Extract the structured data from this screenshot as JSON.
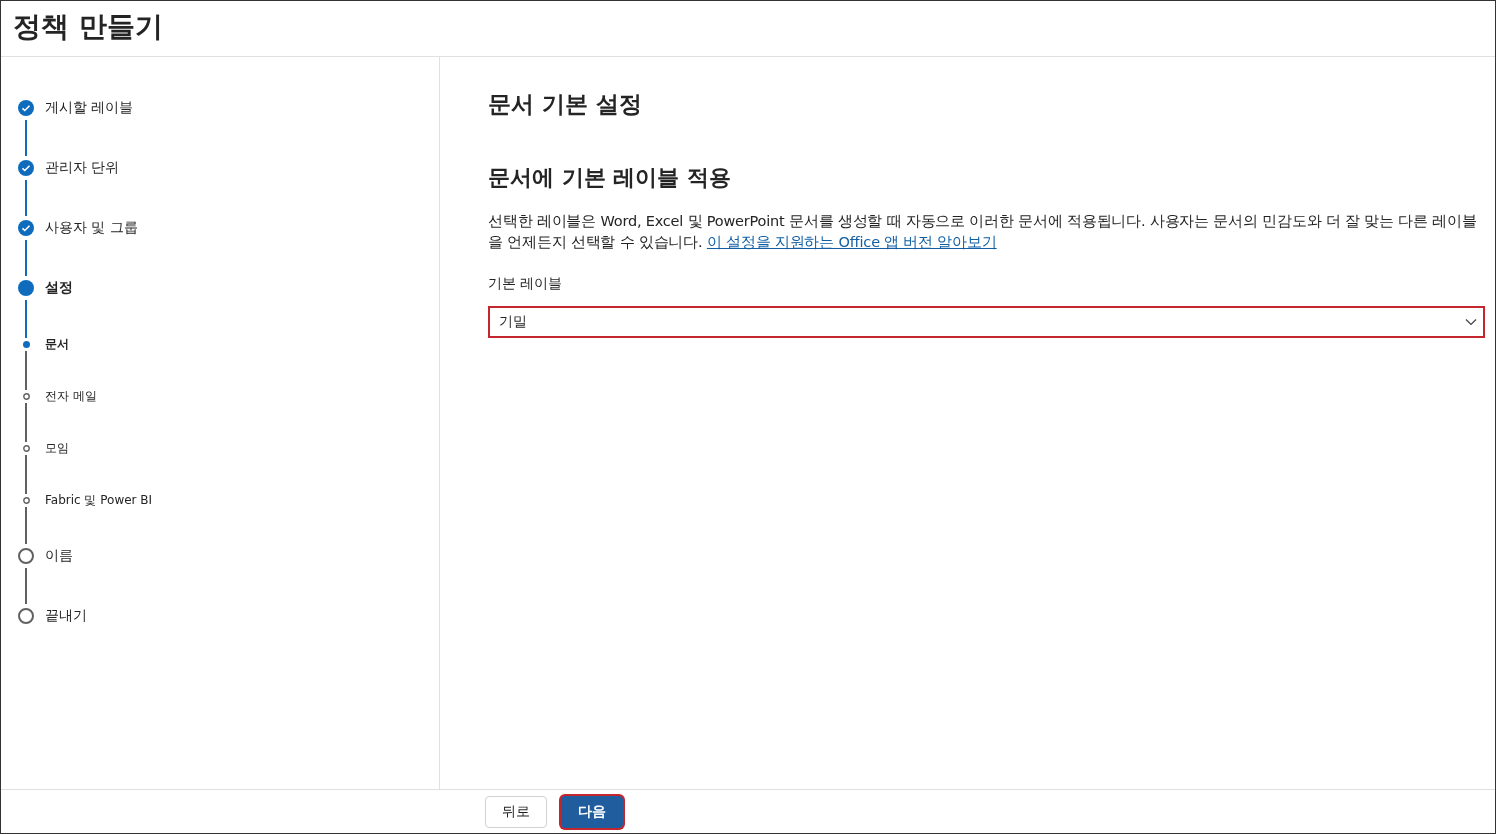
{
  "window": {
    "title": "정책 만들기"
  },
  "steps": [
    {
      "label": "게시할 레이블",
      "kind": "main",
      "done": true,
      "current": false
    },
    {
      "label": "관리자 단위",
      "kind": "main",
      "done": true,
      "current": false
    },
    {
      "label": "사용자 및 그룹",
      "kind": "main",
      "done": true,
      "current": false
    },
    {
      "label": "설정",
      "kind": "main",
      "done": false,
      "current": true
    },
    {
      "label": "문서",
      "kind": "sub",
      "done": false,
      "current": true
    },
    {
      "label": "전자 메일",
      "kind": "sub",
      "done": false,
      "current": false
    },
    {
      "label": "모임",
      "kind": "sub",
      "done": false,
      "current": false
    },
    {
      "label": "Fabric 및 Power BI",
      "kind": "sub",
      "done": false,
      "current": false
    },
    {
      "label": "이름",
      "kind": "main",
      "done": false,
      "current": false
    },
    {
      "label": "끝내기",
      "kind": "main",
      "done": false,
      "current": false
    }
  ],
  "content": {
    "title": "문서 기본 설정",
    "subtitle": "문서에 기본 레이블 적용",
    "description": "선택한 레이블은 Word, Excel 및 PowerPoint 문서를 생성할 때 자동으로 이러한 문서에 적용됩니다. 사용자는 문서의 민감도와 더 잘 맞는 다른 레이블을 언제든지 선택할 수 있습니다.",
    "link": "이 설정을 지원하는 Office 앱 버전 알아보기",
    "field": {
      "label": "기본 레이블",
      "value": "기밀",
      "highlighted": true
    }
  },
  "footer": {
    "buttons": [
      {
        "label": "뒤로",
        "kind": "secondary",
        "highlighted": false
      },
      {
        "label": "다음",
        "kind": "primary",
        "highlighted": true
      }
    ]
  }
}
